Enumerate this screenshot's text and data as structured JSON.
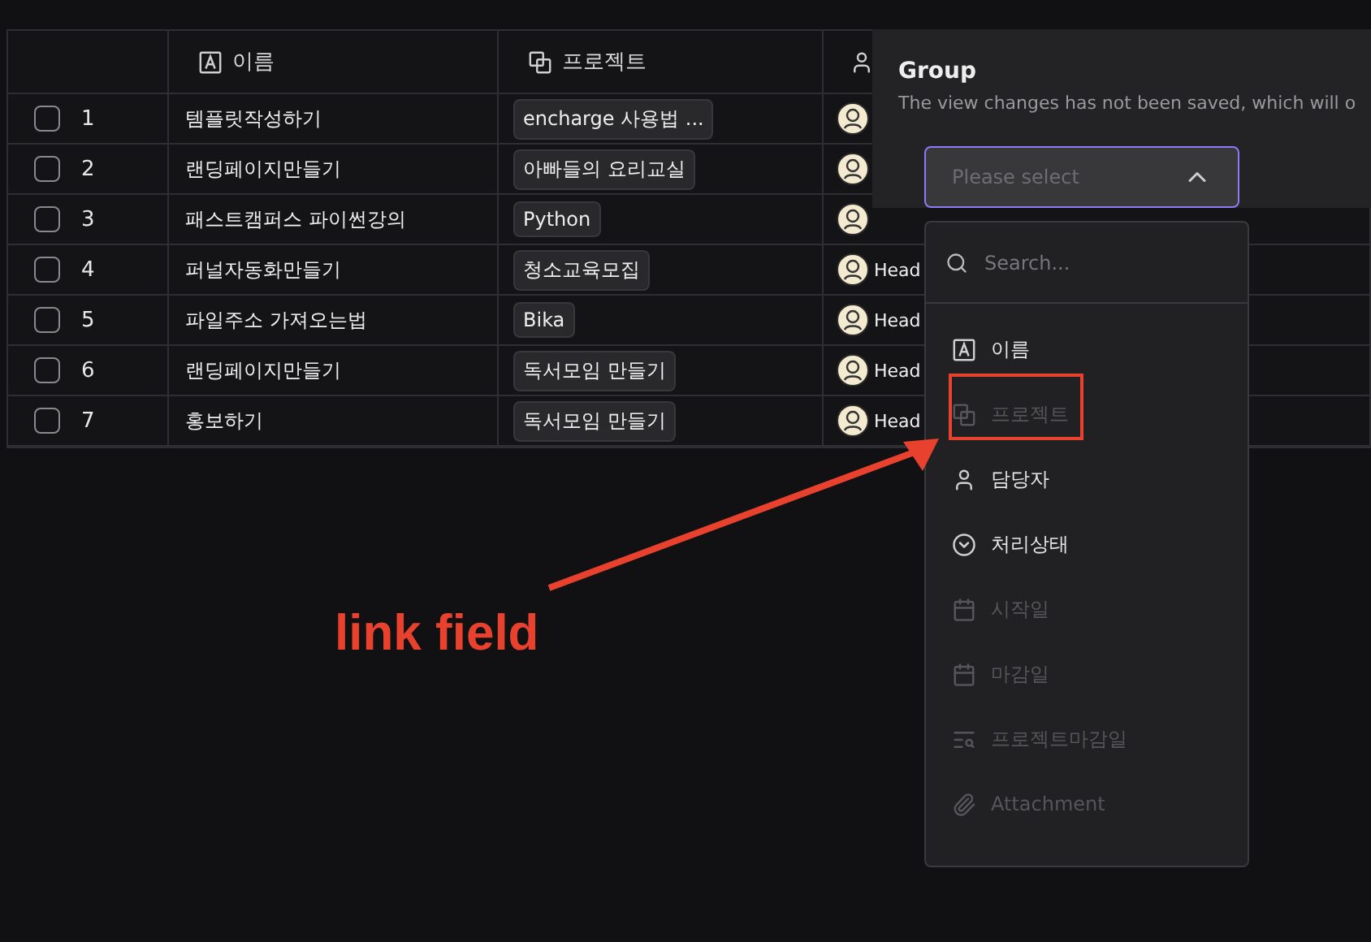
{
  "table": {
    "columns": [
      {
        "label": "이름",
        "kind": "text"
      },
      {
        "label": "프로젝트",
        "kind": "link"
      },
      {
        "kind": "person"
      }
    ],
    "rows": [
      {
        "index": "1",
        "checked": false,
        "name": "템플릿작성하기",
        "project": "encharge 사용법 ..."
      },
      {
        "index": "2",
        "checked": false,
        "name": "랜딩페이지만들기",
        "project": "아빠들의 요리교실"
      },
      {
        "index": "3",
        "checked": false,
        "name": "패스트캠퍼스 파이썬강의",
        "project": "Python"
      },
      {
        "index": "4",
        "checked": false,
        "name": "퍼널자동화만들기",
        "project": "청소교육모집",
        "assignee": "Head"
      },
      {
        "index": "5",
        "checked": false,
        "name": "파일주소 가져오는법",
        "project": "Bika",
        "assignee": "Head"
      },
      {
        "index": "6",
        "checked": false,
        "name": "랜딩페이지만들기",
        "project": "독서모임 만들기",
        "assignee": "Head"
      },
      {
        "index": "7",
        "checked": false,
        "name": "홍보하기",
        "project": "독서모임 만들기",
        "assignee": "Head"
      }
    ]
  },
  "group_panel": {
    "title": "Group",
    "description": "The view changes has not been saved, which will o",
    "select": {
      "placeholder": "Please select",
      "expanded": true
    },
    "search": {
      "placeholder": "Search..."
    },
    "options": [
      {
        "label": "이름",
        "kind": "text",
        "disabled": false,
        "highlighted": false
      },
      {
        "label": "프로젝트",
        "kind": "link",
        "disabled": true,
        "highlighted": true
      },
      {
        "label": "담당자",
        "kind": "person",
        "disabled": false,
        "highlighted": false
      },
      {
        "label": "처리상태",
        "kind": "status",
        "disabled": false,
        "highlighted": false
      },
      {
        "label": "시작일",
        "kind": "date",
        "disabled": true,
        "highlighted": false
      },
      {
        "label": "마감일",
        "kind": "date",
        "disabled": true,
        "highlighted": false
      },
      {
        "label": "프로젝트마감일",
        "kind": "lookup",
        "disabled": true,
        "highlighted": false
      },
      {
        "label": "Attachment",
        "kind": "attachment",
        "disabled": true,
        "highlighted": false
      }
    ]
  },
  "annotation": {
    "text": "link field"
  }
}
